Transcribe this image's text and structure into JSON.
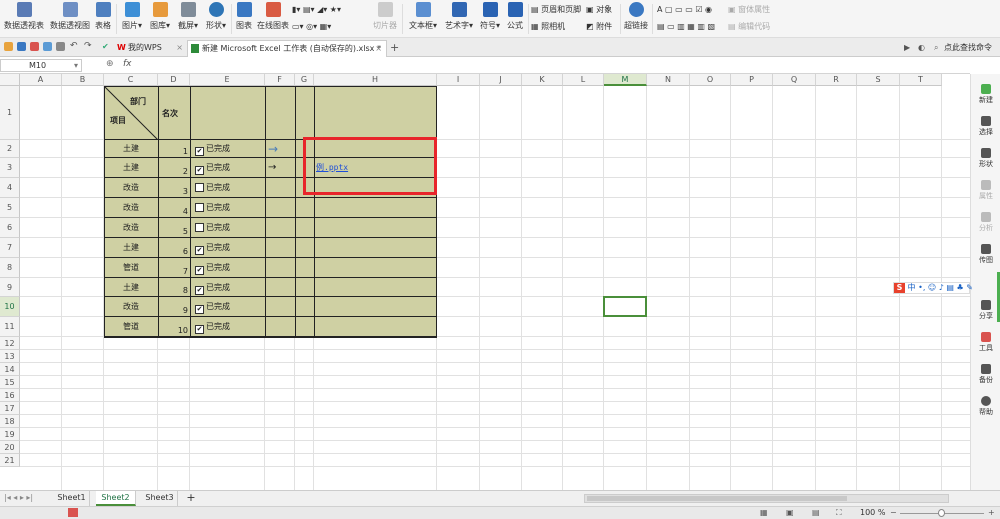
{
  "ribbon": {
    "pivot_table": "数据透视表",
    "pivot_chart": "数据透视图",
    "table": "表格",
    "picture": "图片",
    "gallery": "图库",
    "screenshot": "截屏",
    "shape": "形状",
    "chart": "图表",
    "online_chart": "在线图表",
    "slicer": "切片器",
    "textbox": "文本框",
    "art_text": "艺术字",
    "symbol": "符号",
    "formula": "公式",
    "header_footer": "页眉和页脚",
    "object": "对象",
    "camera": "照相机",
    "attachment": "附件",
    "hyperlink": "超链接",
    "form_properties": "窗体属性",
    "edit_code": "编辑代码"
  },
  "tabs": {
    "home": "我的WPS",
    "doc": "新建 Microsoft Excel 工作表 (自动保存的).xlsx *",
    "help": "点此查找命令"
  },
  "formula": {
    "cell_ref": "M10",
    "fx": "fx"
  },
  "grid": {
    "columns": [
      "A",
      "B",
      "C",
      "D",
      "E",
      "F",
      "G",
      "H",
      "I",
      "J",
      "K",
      "L",
      "M",
      "N",
      "O",
      "P",
      "Q",
      "R",
      "S",
      "T"
    ],
    "rows": [
      "1",
      "2",
      "3",
      "4",
      "5",
      "6",
      "7",
      "8",
      "9",
      "10",
      "11",
      "12",
      "13",
      "14",
      "15",
      "16",
      "17",
      "18",
      "19",
      "20",
      "21"
    ],
    "selected_cell": "M10"
  },
  "table": {
    "corner_top": "部门",
    "corner_bottom": "项目",
    "rank_header": "名次",
    "done_label": "已完成",
    "rows": [
      {
        "dept": "土建",
        "rank": "1",
        "checked": true
      },
      {
        "dept": "土建",
        "rank": "2",
        "checked": true
      },
      {
        "dept": "改造",
        "rank": "3",
        "checked": false
      },
      {
        "dept": "改造",
        "rank": "4",
        "checked": false
      },
      {
        "dept": "改造",
        "rank": "5",
        "checked": false
      },
      {
        "dept": "土建",
        "rank": "6",
        "checked": true
      },
      {
        "dept": "管道",
        "rank": "7",
        "checked": true
      },
      {
        "dept": "土建",
        "rank": "8",
        "checked": true
      },
      {
        "dept": "改造",
        "rank": "9",
        "checked": true
      },
      {
        "dept": "管道",
        "rank": "10",
        "checked": true
      }
    ],
    "link_text": "例.pptx",
    "arrow1": "→",
    "arrow2": "→"
  },
  "right_panel": {
    "new": "新建",
    "select": "选择",
    "shape": "形状",
    "properties": "属性",
    "analysis": "分析",
    "chart": "传图",
    "share": "分享",
    "tools": "工具",
    "backup": "备份",
    "help": "帮助"
  },
  "sheets": [
    "Sheet1",
    "Sheet2",
    "Sheet3"
  ],
  "active_sheet": "Sheet2",
  "status": {
    "zoom": "100 %"
  },
  "ime": {
    "brand": "S",
    "mode": "中"
  },
  "colors": {
    "table_fill": "#cfd0a3",
    "highlight_box": "#e8252b",
    "selection": "#4a8f3a"
  }
}
